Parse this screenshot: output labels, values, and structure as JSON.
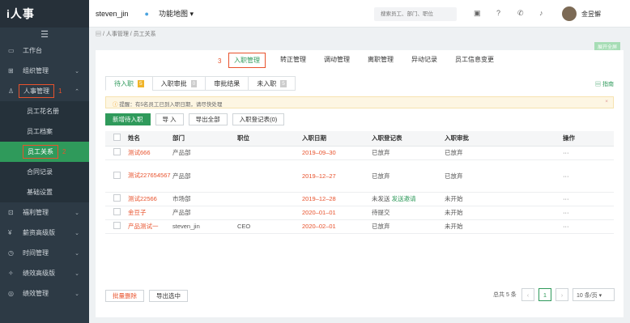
{
  "sidebar": {
    "logo": "i人事",
    "items": [
      {
        "label": "工作台",
        "icon": "monitor-icon"
      },
      {
        "label": "组织管理",
        "icon": "org-icon"
      },
      {
        "label": "人事管理",
        "icon": "person-icon"
      },
      {
        "label": "福利管理",
        "icon": "gift-icon"
      },
      {
        "label": "薪资高级版",
        "icon": "salary-icon"
      },
      {
        "label": "时间管理",
        "icon": "clock-icon"
      },
      {
        "label": "绩效高级版",
        "icon": "performance-icon"
      },
      {
        "label": "绩效管理",
        "icon": "target-icon"
      }
    ],
    "sub_items": [
      "员工花名册",
      "员工档案",
      "员工关系",
      "合同记录",
      "基础设置"
    ],
    "marker1": "1",
    "marker2": "2"
  },
  "topbar": {
    "user": "steven_jin",
    "map": "功能地图",
    "search_placeholder": "搜索员工、部门、职位",
    "username": "金昱懈"
  },
  "breadcrumb": "人事管理 / 员工关系",
  "open_all": "展开全屏",
  "tabs": {
    "marker": "3",
    "items": [
      "入职管理",
      "转正管理",
      "调动管理",
      "离职管理",
      "异动记录",
      "员工信息变更"
    ]
  },
  "subtabs": [
    {
      "label": "待入职",
      "count": "5"
    },
    {
      "label": "入职审批",
      "count": "0"
    },
    {
      "label": "审批结果",
      "count": ""
    },
    {
      "label": "未入职",
      "count": "5"
    }
  ],
  "guide": "指南",
  "notice": "提醒：有5名员工已到入职日期，请尽快处理",
  "buttons": {
    "add": "新增待入职",
    "import": "导 入",
    "export_all": "导出全部",
    "reg_form": "入职登记表(0)"
  },
  "table": {
    "headers": [
      "姓名",
      "部门",
      "职位",
      "入职日期",
      "入职登记表",
      "入职审批",
      "操作"
    ],
    "rows": [
      {
        "name": "测试666",
        "dept": "产品部",
        "pos": "",
        "date": "2019–09–30",
        "reg": "已放弃",
        "invite": "",
        "approval": "已放弃",
        "op": "···"
      },
      {
        "name": "测试227654567",
        "dept": "产品部",
        "pos": "",
        "date": "2019–12–27",
        "reg": "已放弃",
        "invite": "",
        "approval": "已放弃",
        "op": "···"
      },
      {
        "name": "测试22566",
        "dept": "市场部",
        "pos": "",
        "date": "2019–12–28",
        "reg": "未发送",
        "invite": "发送邀请",
        "approval": "未开始",
        "op": "···"
      },
      {
        "name": "金豆子",
        "dept": "产品部",
        "pos": "",
        "date": "2020–01–01",
        "reg": "待提交",
        "invite": "",
        "approval": "未开始",
        "op": "···"
      },
      {
        "name": "产品测试一",
        "dept": "steven_jin",
        "pos": "CEO",
        "date": "2020–02–01",
        "reg": "已放弃",
        "invite": "",
        "approval": "未开始",
        "op": "···"
      }
    ]
  },
  "footer": {
    "batch_delete": "批量删除",
    "export_selected": "导出选中",
    "total": "总共 5 条",
    "page": "1",
    "per_page": "10 条/页"
  }
}
